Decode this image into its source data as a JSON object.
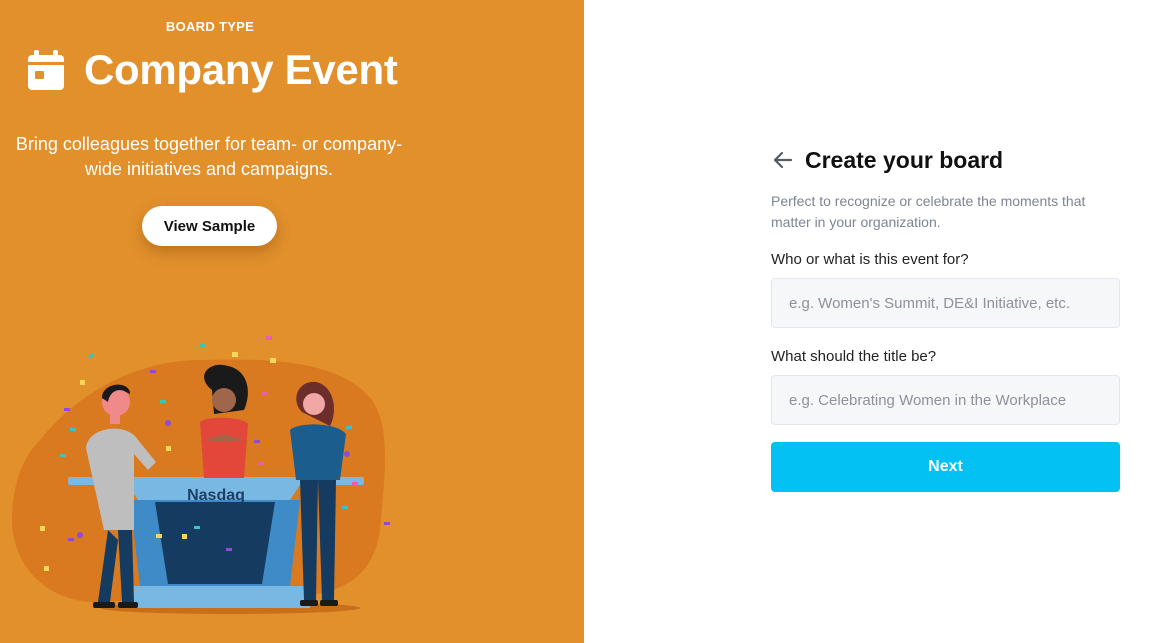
{
  "left_panel": {
    "board_type_label": "BOARD TYPE",
    "title": "Company Event",
    "icon": "calendar-icon",
    "description": "Bring colleagues together for team- or company-wide initiatives and campaigns.",
    "view_sample_label": "View Sample",
    "illustration": {
      "podium_label": "Nasdaq"
    },
    "colors": {
      "background": "#E1902C",
      "blob": "#D97A20"
    }
  },
  "form": {
    "back_icon": "arrow-left-icon",
    "title": "Create your board",
    "subtitle": "Perfect to recognize or celebrate the moments that matter in your organization.",
    "fields": [
      {
        "label": "Who or what is this event for?",
        "placeholder": "e.g. Women's Summit, DE&I Initiative, etc.",
        "value": ""
      },
      {
        "label": "What should the title be?",
        "placeholder": "e.g. Celebrating Women in the Workplace",
        "value": ""
      }
    ],
    "next_label": "Next",
    "colors": {
      "primary": "#03C1F3"
    }
  }
}
